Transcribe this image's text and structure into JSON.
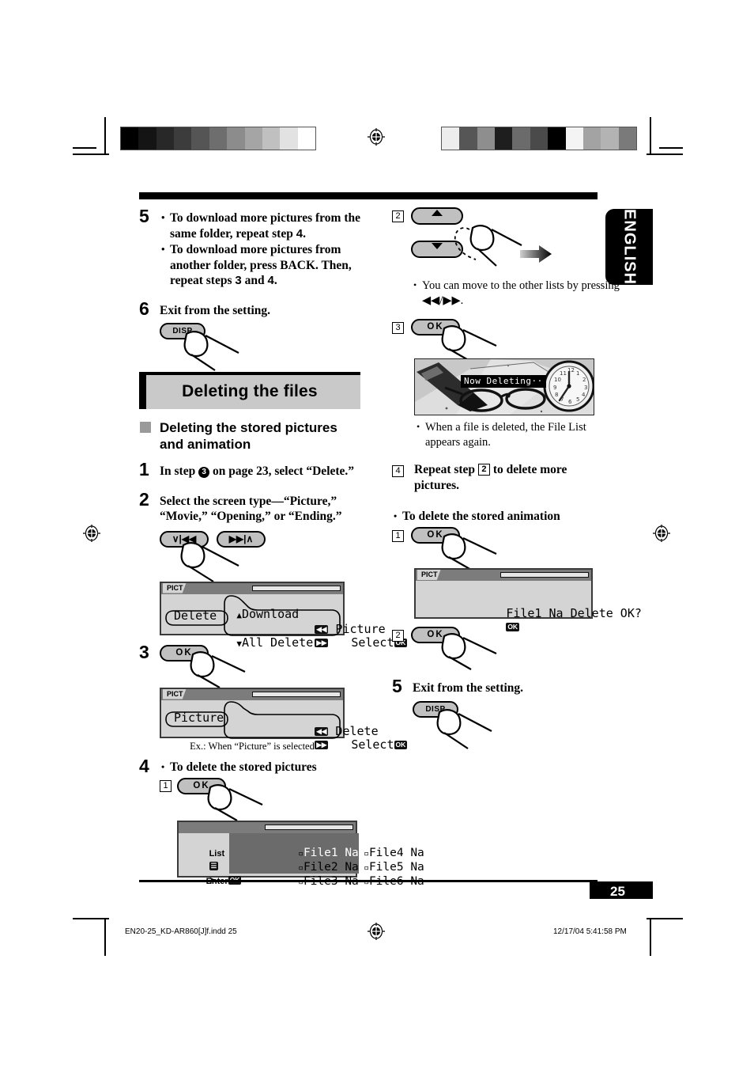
{
  "page": {
    "number": "25",
    "language_tab": "ENGLISH",
    "footer_file": "EN20-25_KD-AR860[J]f.indd   25",
    "footer_date": "12/17/04   5:41:58 PM"
  },
  "left_column": {
    "step5": {
      "num": "5",
      "bullets": [
        "To download more pictures from the same folder, repeat step 4.",
        "To download more pictures from another folder, press BACK. Then, repeat steps 3 and 4."
      ]
    },
    "step6": {
      "num": "6",
      "text": "Exit from the setting.",
      "button": "DISP"
    },
    "section_title": "Deleting the files",
    "subsection_title": "Deleting the stored pictures and animation",
    "step1": {
      "num": "1",
      "text_before": "In step ",
      "circled": "3",
      "text_after": " on page 23, select “Delete.”"
    },
    "step2": {
      "num": "2",
      "text": "Select the screen type—“Picture,” “Movie,” “Opening,” or “Ending.”",
      "button_left": "∨|◀◀",
      "button_right": "▶▶|∧"
    },
    "lcd_menu": {
      "tag": "PICT",
      "row1": "Download",
      "row2_left": "Delete",
      "row2_center": "Picture",
      "row3_left": "All Delete",
      "row3_right": "Select",
      "key_ok": "OK"
    },
    "step3": {
      "num": "3",
      "button": "OK"
    },
    "lcd_selected": {
      "tag": "PICT",
      "left": "Picture",
      "center": "Delete",
      "right": "Select",
      "key_ok": "OK"
    },
    "lcd_selected_caption": "Ex.: When “Picture” is selected",
    "step4": {
      "num": "4",
      "bullet": "To delete the stored pictures",
      "substep1": "1",
      "button": "OK"
    },
    "file_list": {
      "label_list": "List",
      "label_enter": "Enter",
      "key_ok": "OK",
      "files_col1": [
        "File1 Na",
        "File2 Na",
        "File3 Na"
      ],
      "files_col2": [
        "File4 Na",
        "File5 Na",
        "File6 Na"
      ],
      "selected": "File1 Na"
    }
  },
  "right_column": {
    "step2": {
      "num": "2",
      "note": "You can move to the other lists by pressing ◀◀/▶▶."
    },
    "step3": {
      "num": "3",
      "button": "OK"
    },
    "photo": {
      "overlay_text": "Now Deleting··",
      "note": "When a file is deleted, the File List appears again."
    },
    "step4": {
      "num": "4",
      "text_before": "Repeat step ",
      "ref": "2",
      "text_after": " to delete more pictures."
    },
    "animation_bullet": "To delete the stored animation",
    "anim_step1": {
      "num": "1",
      "button": "OK"
    },
    "lcd_confirm": {
      "tag": "PICT",
      "text": "File1 Na Delete OK?",
      "key_ok": "OK"
    },
    "anim_step2": {
      "num": "2",
      "button": "OK"
    },
    "step5": {
      "num": "5",
      "text": "Exit from the setting.",
      "button": "DISP"
    }
  },
  "swatches": {
    "left_bar": [
      "#000000",
      "#141414",
      "#282828",
      "#3c3c3c",
      "#555555",
      "#6e6e6e",
      "#8c8c8c",
      "#a5a5a5",
      "#c0c0c0",
      "#e2e2e2",
      "#ffffff"
    ],
    "right_bar": [
      "#ededed",
      "#565656",
      "#8e8e8e",
      "#1e1e1e",
      "#6b6b6b",
      "#4a4a4a",
      "#000000",
      "#f4f4f4",
      "#a3a3a3",
      "#b3b3b3",
      "#7a7a7a"
    ]
  }
}
